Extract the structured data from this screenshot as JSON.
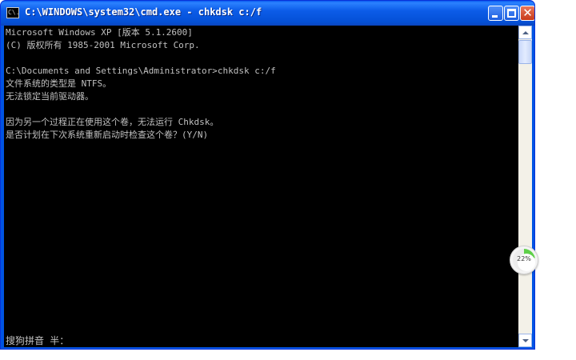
{
  "window": {
    "title": "C:\\WINDOWS\\system32\\cmd.exe - chkdsk c:/f",
    "icon_text": "C\\."
  },
  "console": {
    "lines": [
      "Microsoft Windows XP [版本 5.1.2600]",
      "(C) 版权所有 1985-2001 Microsoft Corp.",
      "",
      "C:\\Documents and Settings\\Administrator>chkdsk c:/f",
      "文件系统的类型是 NTFS。",
      "无法锁定当前驱动器。",
      "",
      "因为另一个过程正在使用这个卷，无法运行 Chkdsk。",
      "是否计划在下次系统重新启动时检查这个卷？(Y/N)"
    ],
    "ime_status": "搜狗拼音 半："
  },
  "progress_widget": {
    "label": "22%",
    "value_percent": 22
  },
  "colors": {
    "console_bg": "#000000",
    "console_text": "#c0c0c0",
    "titlebar": "#0054e3",
    "progress_accent": "#5fd04a"
  },
  "icons": [
    "cmd-icon",
    "minimize-icon",
    "maximize-icon",
    "close-icon",
    "scroll-up-arrow-icon",
    "scroll-down-arrow-icon"
  ]
}
